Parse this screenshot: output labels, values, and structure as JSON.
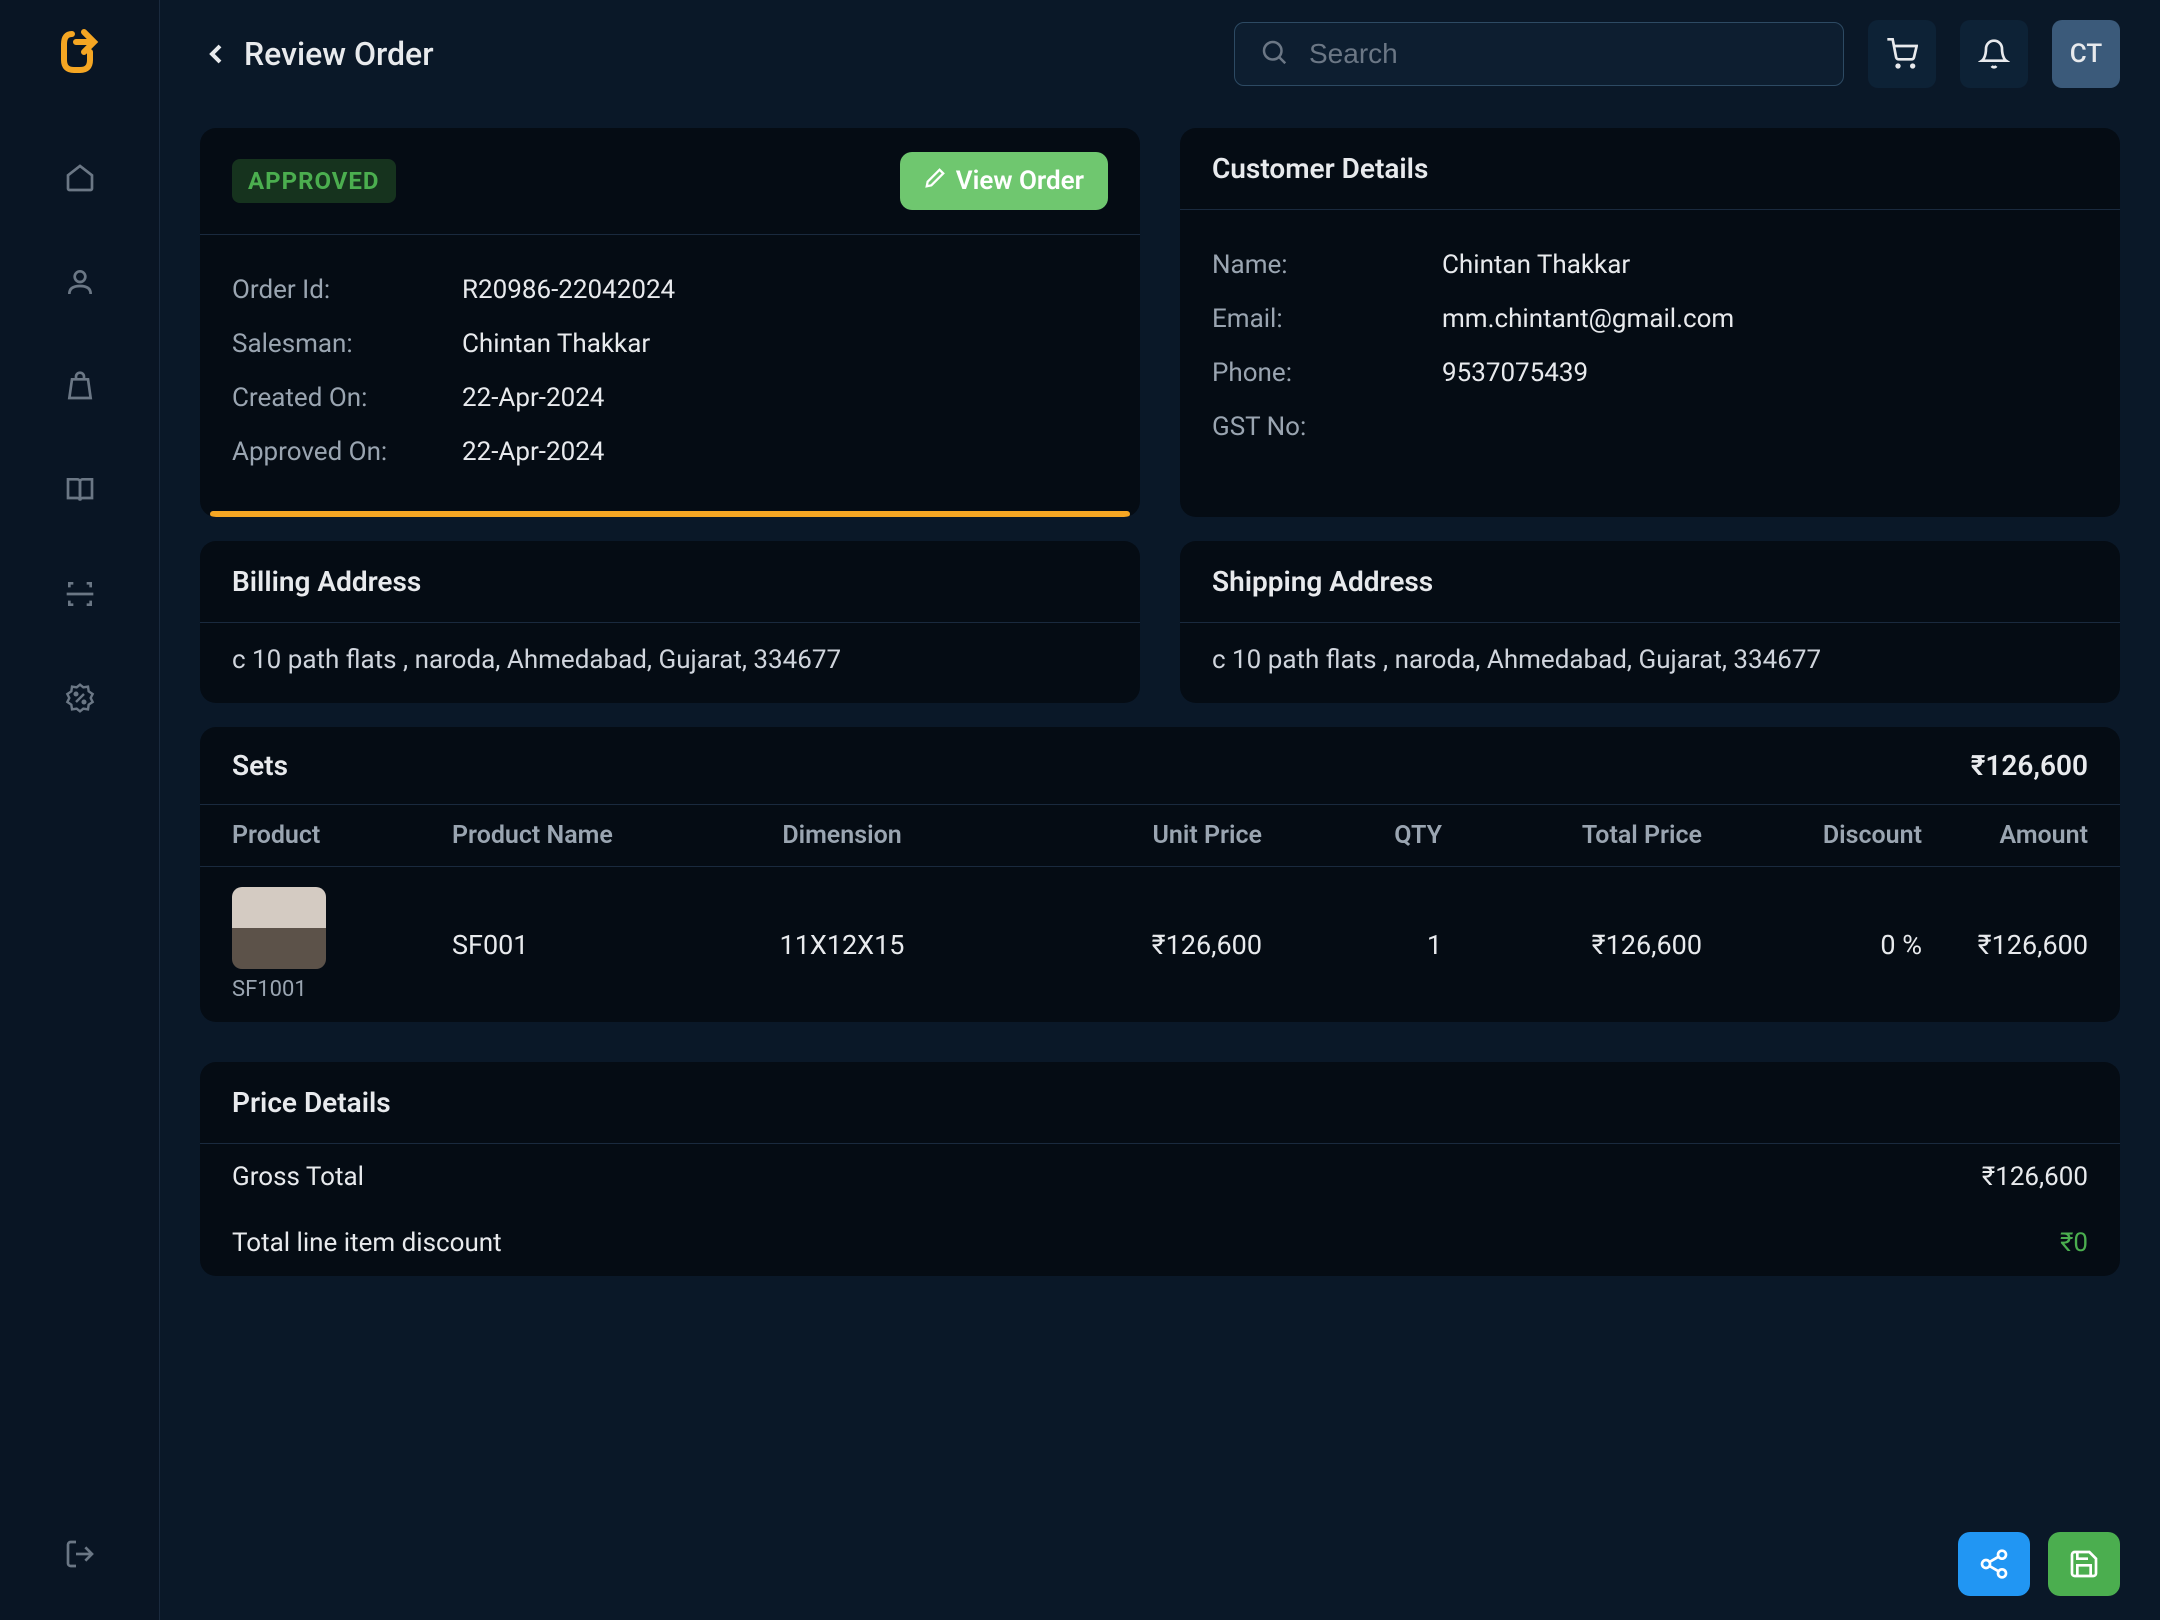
{
  "header": {
    "title": "Review Order",
    "searchPlaceholder": "Search",
    "avatarInitials": "CT"
  },
  "order": {
    "status": "APPROVED",
    "viewOrderLabel": "View Order",
    "rows": [
      {
        "label": "Order Id:",
        "value": "R20986-22042024"
      },
      {
        "label": "Salesman:",
        "value": "Chintan Thakkar"
      },
      {
        "label": "Created On:",
        "value": "22-Apr-2024"
      },
      {
        "label": "Approved On:",
        "value": "22-Apr-2024"
      }
    ]
  },
  "customer": {
    "title": "Customer Details",
    "rows": [
      {
        "label": "Name:",
        "value": "Chintan Thakkar"
      },
      {
        "label": "Email:",
        "value": "mm.chintant@gmail.com"
      },
      {
        "label": "Phone:",
        "value": "9537075439"
      },
      {
        "label": "GST No:",
        "value": ""
      }
    ]
  },
  "billing": {
    "title": "Billing Address",
    "address": "c 10 path flats , naroda, Ahmedabad, Gujarat, 334677"
  },
  "shipping": {
    "title": "Shipping Address",
    "address": "c 10 path flats , naroda, Ahmedabad, Gujarat, 334677"
  },
  "sets": {
    "title": "Sets",
    "total": "₹126,600",
    "columns": {
      "product": "Product",
      "name": "Product Name",
      "dimension": "Dimension",
      "unitPrice": "Unit Price",
      "qty": "QTY",
      "totalPrice": "Total Price",
      "discount": "Discount",
      "amount": "Amount"
    },
    "items": [
      {
        "code": "SF1001",
        "name": "SF001",
        "dimension": "11X12X15",
        "unitPrice": "₹126,600",
        "qty": "1",
        "totalPrice": "₹126,600",
        "discount": "0 %",
        "amount": "₹126,600"
      }
    ]
  },
  "priceDetails": {
    "title": "Price Details",
    "rows": [
      {
        "label": "Gross Total",
        "value": "₹126,600",
        "green": false
      },
      {
        "label": "Total line item discount",
        "value": "₹0",
        "green": true
      }
    ]
  }
}
